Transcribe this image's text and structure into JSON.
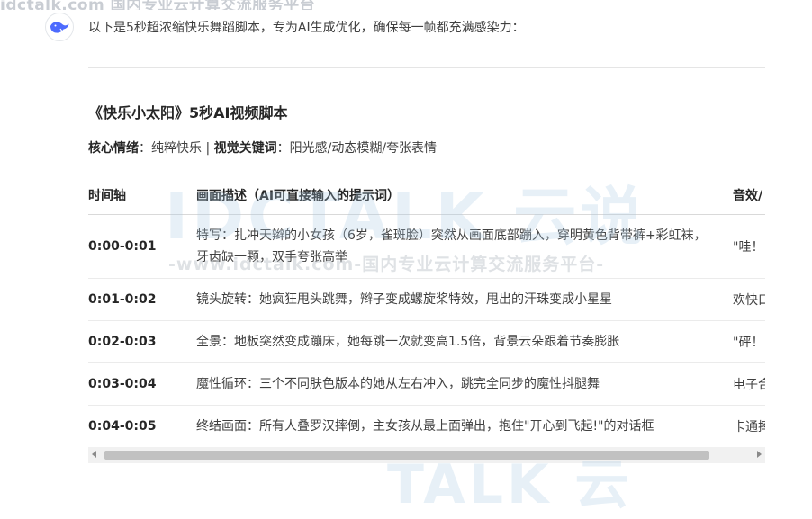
{
  "top_watermark": "idctalk.com 国内专业云计算交流服务平台",
  "assistant": {
    "avatar_icon": "whale-logo-icon",
    "brand_color": "#4d6bfe"
  },
  "intro": "以下是5秒超浓缩快乐舞蹈脚本，专为AI生成优化，确保每一帧都充满感染力：",
  "script_title": "《快乐小太阳》5秒AI视频脚本",
  "summary": {
    "emotion_label": "核心情绪",
    "emotion_value": "纯粹快乐",
    "separator": "|",
    "keywords_label": "视觉关键词",
    "keywords_value": "阳光感/动态模糊/夸张表情"
  },
  "table": {
    "headers": [
      "时间轴",
      "画面描述（AI可直接输入的提示词）",
      "音效/"
    ],
    "rows": [
      {
        "time": "0:00-0:01",
        "desc": "特写：扎冲天辫的小女孩（6岁，雀斑脸）突然从画面底部蹦入，穿明黄色背带裤+彩虹袜，牙齿缺一颗，双手夸张高举",
        "sfx": "\"哇！"
      },
      {
        "time": "0:01-0:02",
        "desc": "镜头旋转：她疯狂甩头跳舞，辫子变成螺旋桨特效，甩出的汗珠变成小星星",
        "sfx": "欢快口"
      },
      {
        "time": "0:02-0:03",
        "desc": "全景：地板突然变成蹦床，她每跳一次就变高1.5倍，背景云朵跟着节奏膨胀",
        "sfx": "\"砰！"
      },
      {
        "time": "0:03-0:04",
        "desc": "魔性循环：三个不同肤色版本的她从左右冲入，跳完全同步的魔性抖腿舞",
        "sfx": "电子合"
      },
      {
        "time": "0:04-0:05",
        "desc": "终结画面：所有人叠罗汉摔倒，主女孩从最上面弹出，抱住\"开心到飞起!\"的对话框",
        "sfx": "卡通摔"
      }
    ]
  },
  "watermark": {
    "main": "IDCTALK 云说",
    "sub": "-www.idctalk.com-国内专业云计算交流服务平台-",
    "bottom": "TALK 云"
  }
}
